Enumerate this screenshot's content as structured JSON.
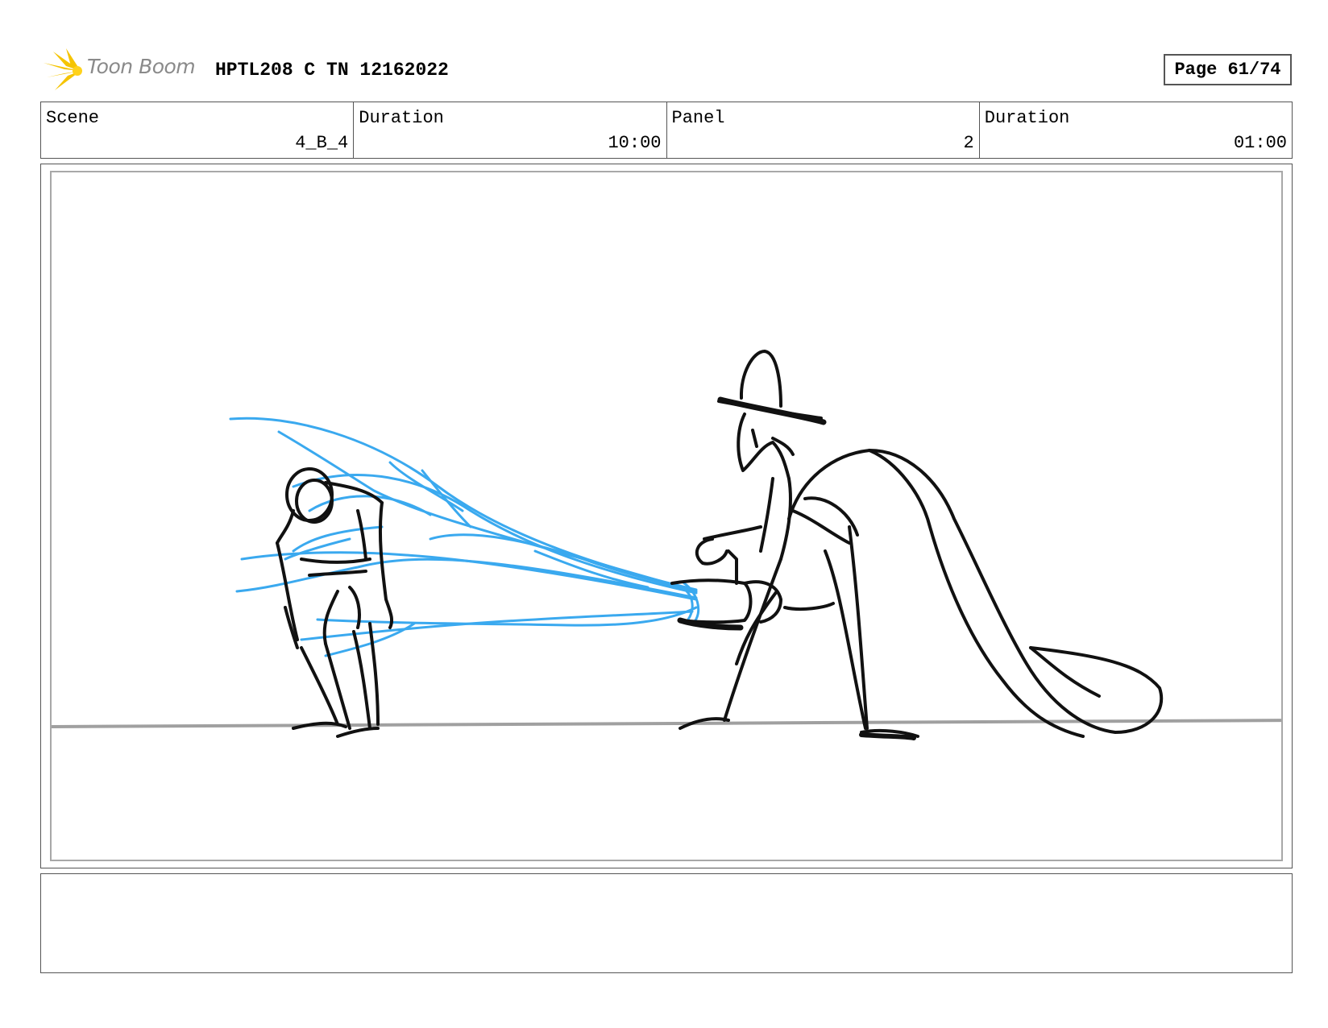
{
  "header": {
    "logo_text": "Toon Boom",
    "title": "HPTL208 C TN 12162022",
    "page": "Page 61/74"
  },
  "info": {
    "scene_label": "Scene",
    "scene_value": "4_B_4",
    "scene_duration_label": "Duration",
    "scene_duration_value": "10:00",
    "panel_label": "Panel",
    "panel_value": "2",
    "panel_duration_label": "Duration",
    "panel_duration_value": "01:00"
  },
  "notes": {
    "text": ""
  },
  "colors": {
    "sketch_line": "#111111",
    "water_stroke": "#3aa9ef",
    "ground_line": "#a0a0a0",
    "logo_star": "#f5c400"
  }
}
